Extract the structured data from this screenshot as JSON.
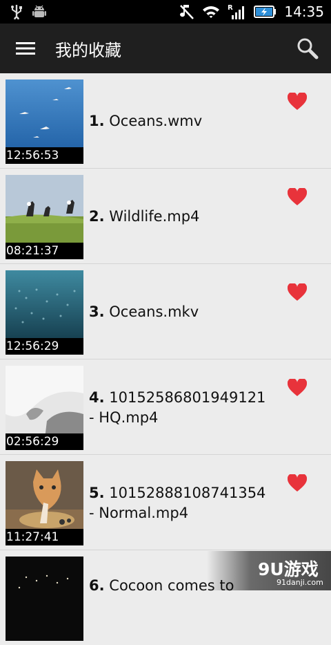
{
  "status_bar": {
    "time": "14:35",
    "icons": [
      "usb-icon",
      "android-debug-icon",
      "no-sound-icon",
      "wifi-icon",
      "roaming-icon",
      "signal-icon",
      "battery-charging-icon"
    ]
  },
  "action_bar": {
    "title": "我的收藏",
    "menu_icon": "menu-icon",
    "search_icon": "search-icon"
  },
  "videos": [
    {
      "index": "1.",
      "name": "Oceans.wmv",
      "duration": "12:56:53",
      "favorite": true
    },
    {
      "index": "2.",
      "name": "Wildlife.mp4",
      "duration": "08:21:37",
      "favorite": true
    },
    {
      "index": "3.",
      "name": "Oceans.mkv",
      "duration": "12:56:29",
      "favorite": true
    },
    {
      "index": "4.",
      "name": "10152586801949121 - HQ.mp4",
      "duration": "02:56:29",
      "favorite": true
    },
    {
      "index": "5.",
      "name": "10152888108741354 - Normal.mp4",
      "duration": "11:27:41",
      "favorite": true
    },
    {
      "index": "6.",
      "name": "Cocoon comes to",
      "duration": "",
      "favorite": false
    }
  ],
  "watermark": {
    "logo": "9U游戏",
    "url": "91danji.com"
  },
  "colors": {
    "action_bar": "#1f1f1f",
    "list_bg": "#ececec",
    "heart": "#e8333b"
  }
}
